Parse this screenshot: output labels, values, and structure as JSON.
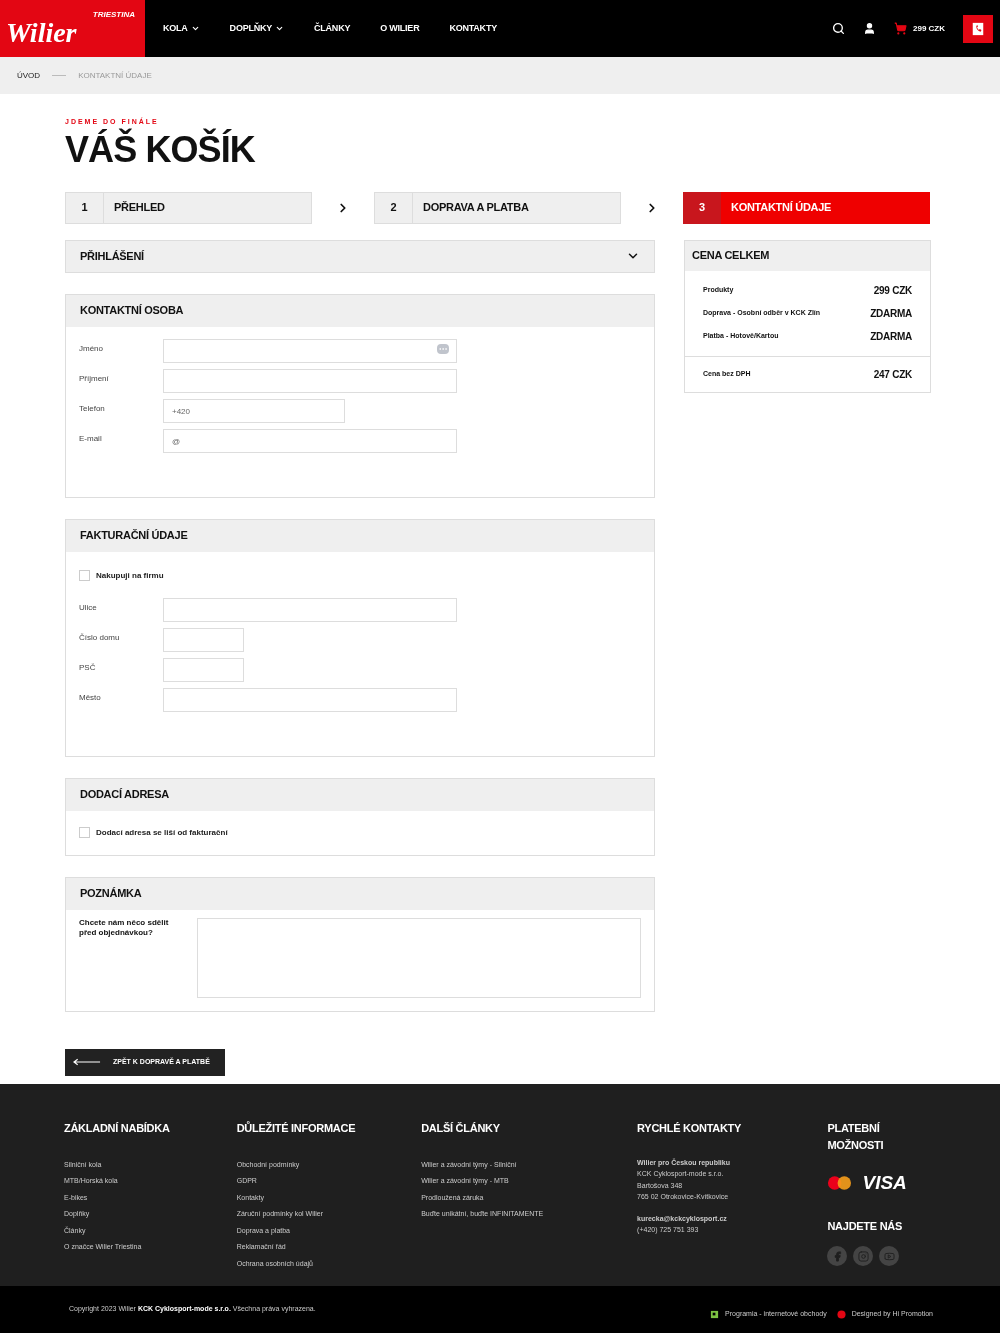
{
  "header": {
    "logo": "Wilier",
    "logo_sub": "TRIESTINA",
    "nav": [
      {
        "label": "KOLA",
        "dropdown": true
      },
      {
        "label": "DOPLŇKY",
        "dropdown": true
      },
      {
        "label": "ČLÁNKY",
        "dropdown": false
      },
      {
        "label": "O WILIER",
        "dropdown": false
      },
      {
        "label": "KONTAKTY",
        "dropdown": false
      }
    ],
    "cart_total": "299 CZK"
  },
  "breadcrumb": [
    "ÚVOD",
    "KONTAKTNÍ ÚDAJE"
  ],
  "eyebrow": "JDEME DO FINÁLE",
  "title": "VÁŠ KOŠÍK",
  "steps": [
    {
      "number": "1",
      "label": "PŘEHLED",
      "selected": false
    },
    {
      "number": "2",
      "label": "DOPRAVA A PLATBA",
      "selected": false
    },
    {
      "number": "3",
      "label": "KONTAKTNÍ ÚDAJE",
      "selected": true
    }
  ],
  "login": {
    "title": "PŘIHLÁŠENÍ",
    "expanded": false
  },
  "sections": [
    {
      "title": "KONTAKTNÍ OSOBA",
      "fields": [
        {
          "label": "Jméno",
          "kind": "text",
          "autofill_icon": true
        },
        {
          "label": "Příjmení",
          "kind": "text"
        },
        {
          "label": "Telefon",
          "kind": "phone",
          "placeholder": "+420"
        },
        {
          "label": "E-mail",
          "kind": "text",
          "placeholder": "@"
        }
      ]
    },
    {
      "title": "FAKTURAČNÍ ÚDAJE",
      "checkbox": {
        "label": "Nakupuji na firmu",
        "checked": false
      },
      "fields": [
        {
          "label": "Ulice",
          "kind": "text"
        },
        {
          "label": "Číslo domu",
          "kind": "number"
        },
        {
          "label": "PSČ",
          "kind": "number"
        },
        {
          "label": "Město",
          "kind": "text"
        }
      ]
    },
    {
      "title": "DODACÍ ADRESA",
      "checkbox": {
        "label": "Dodací adresa se liší od fakturační",
        "checked": false
      }
    }
  ],
  "note": {
    "title": "POZNÁMKA",
    "label": "Chcete nám něco sdělit před objednávkou?"
  },
  "back_button": "ZPĚT K DOPRAVĚ A PLATBĚ",
  "summary": {
    "title": "CENA CELKEM",
    "rows": [
      {
        "label": "Produkty",
        "value": "299 CZK"
      },
      {
        "label": "Doprava",
        "detail": "- Osobní odběr v KCK Zlín",
        "value": "ZDARMA"
      },
      {
        "label": "Platba",
        "detail": "- Hotově/Kartou",
        "value": "ZDARMA"
      }
    ],
    "net_row": {
      "label": "Cena bez DPH",
      "value": "247 CZK"
    }
  },
  "footer": {
    "columns": [
      {
        "title": "ZÁKLADNÍ NABÍDKA",
        "links": [
          "Silniční kola",
          "MTB/Horská kola",
          "E-bikes",
          "Doplňky",
          "Články",
          "O značce Wilier Triestina"
        ]
      },
      {
        "title": "DŮLEŽITÉ INFORMACE",
        "links": [
          "Obchodní podmínky",
          "GDPR",
          "Kontakty",
          "Záruční podmínky kol Wilier",
          "Doprava a platba",
          "Reklamační řád",
          "Ochrana osobních údajů"
        ]
      },
      {
        "title": "DALŠÍ ČLÁNKY",
        "links": [
          "Wilier a závodní týmy - Silniční",
          "Wilier a závodní týmy - MTB",
          "Prodloužená záruka",
          "Buďte unikátní, buďte INFINITAMENTE"
        ]
      }
    ],
    "contacts": {
      "title": "RYCHLÉ KONTAKTY",
      "company": "Wilier pro Českou republiku",
      "address": [
        "KCK Cyklosport-mode s.r.o.",
        "Bartošova 348",
        "765 02 Otrokovice-Kvítkovice"
      ],
      "email": "kurecka@kckcyklosport.cz",
      "phone": "(+420) 725 751 393"
    },
    "payments": {
      "title": "PLATEBNÍ MOŽNOSTI",
      "visa": "VISA"
    },
    "social": {
      "title": "NAJDETE NÁS"
    },
    "copyright": "Copyright 2023 Wilier **KCK Cyklosport-mode s.r.o.** Všechna práva vyhrazena.",
    "credits": [
      "Programia - internetové obchody",
      "Designed by Hi Promotion"
    ]
  }
}
